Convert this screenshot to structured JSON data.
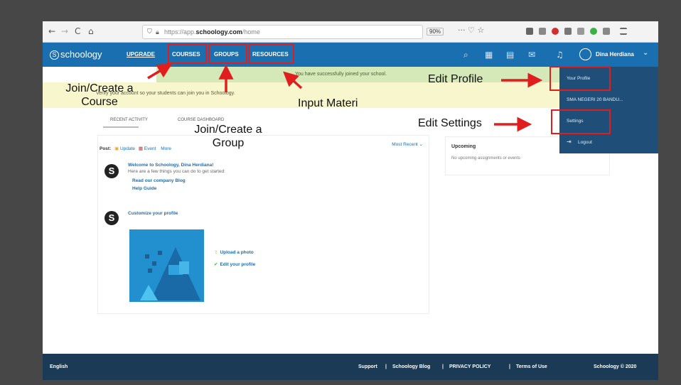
{
  "browser": {
    "nav": [
      "←",
      "→",
      "C",
      "⌂"
    ],
    "url_prefix": "https://app.",
    "url_domain": "schoology.com",
    "url_path": "/home",
    "zoom": "90%",
    "tools": "··· ♡ ☆"
  },
  "header": {
    "logo_text": "schoology",
    "logo_mark": "S",
    "nav": {
      "upgrade": "UPGRADE",
      "courses": "COURSES",
      "groups": "GROUPS",
      "resources": "RESOURCES"
    },
    "icons": {
      "search": "⌕",
      "apps": "▦",
      "calendar": "▤",
      "messages": "✉",
      "notifications": "♫"
    },
    "user_name": "Dina Herdiana",
    "caret": "⌄"
  },
  "banners": {
    "joined": "You have successfully joined your school.",
    "verify": "Verify your account so your students can join you in Schoology."
  },
  "tabs": {
    "recent": "RECENT ACTIVITY",
    "dashboard": "COURSE DASHBOARD"
  },
  "feed": {
    "post_label": "Post:",
    "update": "Update",
    "event": "Event",
    "more": "More",
    "most_recent": "Most Recent ⌄",
    "welcome_title": "Welcome to Schoology, Dina Herdiana!",
    "welcome_sub": "Here are a few things you can do to get started:",
    "link_blog": "Read our company Blog",
    "link_help": "Help Guide",
    "customize": "Customize your profile",
    "upload_photo": "Upload a photo",
    "edit_profile": "Edit your profile"
  },
  "upcoming": {
    "title": "Upcoming",
    "empty": "No upcoming assignments or events"
  },
  "user_menu": {
    "your_profile": "Your Profile",
    "school": "SMA NEGERI 20 BANDU...",
    "settings": "Settings",
    "logout": "Logout"
  },
  "footer": {
    "language": "English",
    "support": "Support",
    "blog": "Schoology Blog",
    "privacy": "PRIVACY POLICY",
    "terms": "Terms of Use",
    "copyright": "Schoology © 2020",
    "separator": "|"
  },
  "annotations": {
    "join_course_1": "Join/Create a",
    "join_course_2": "Course",
    "join_group_1": "Join/Create a",
    "join_group_2": "Group",
    "input_materi": "Input Materi",
    "edit_profile": "Edit Profile",
    "edit_settings": "Edit Settings"
  },
  "colors": {
    "brand_blue": "#1a6fb0",
    "annotation_red": "#e01e1e",
    "menu_bg": "#1f4f78",
    "footer_bg": "#1b3a56"
  }
}
